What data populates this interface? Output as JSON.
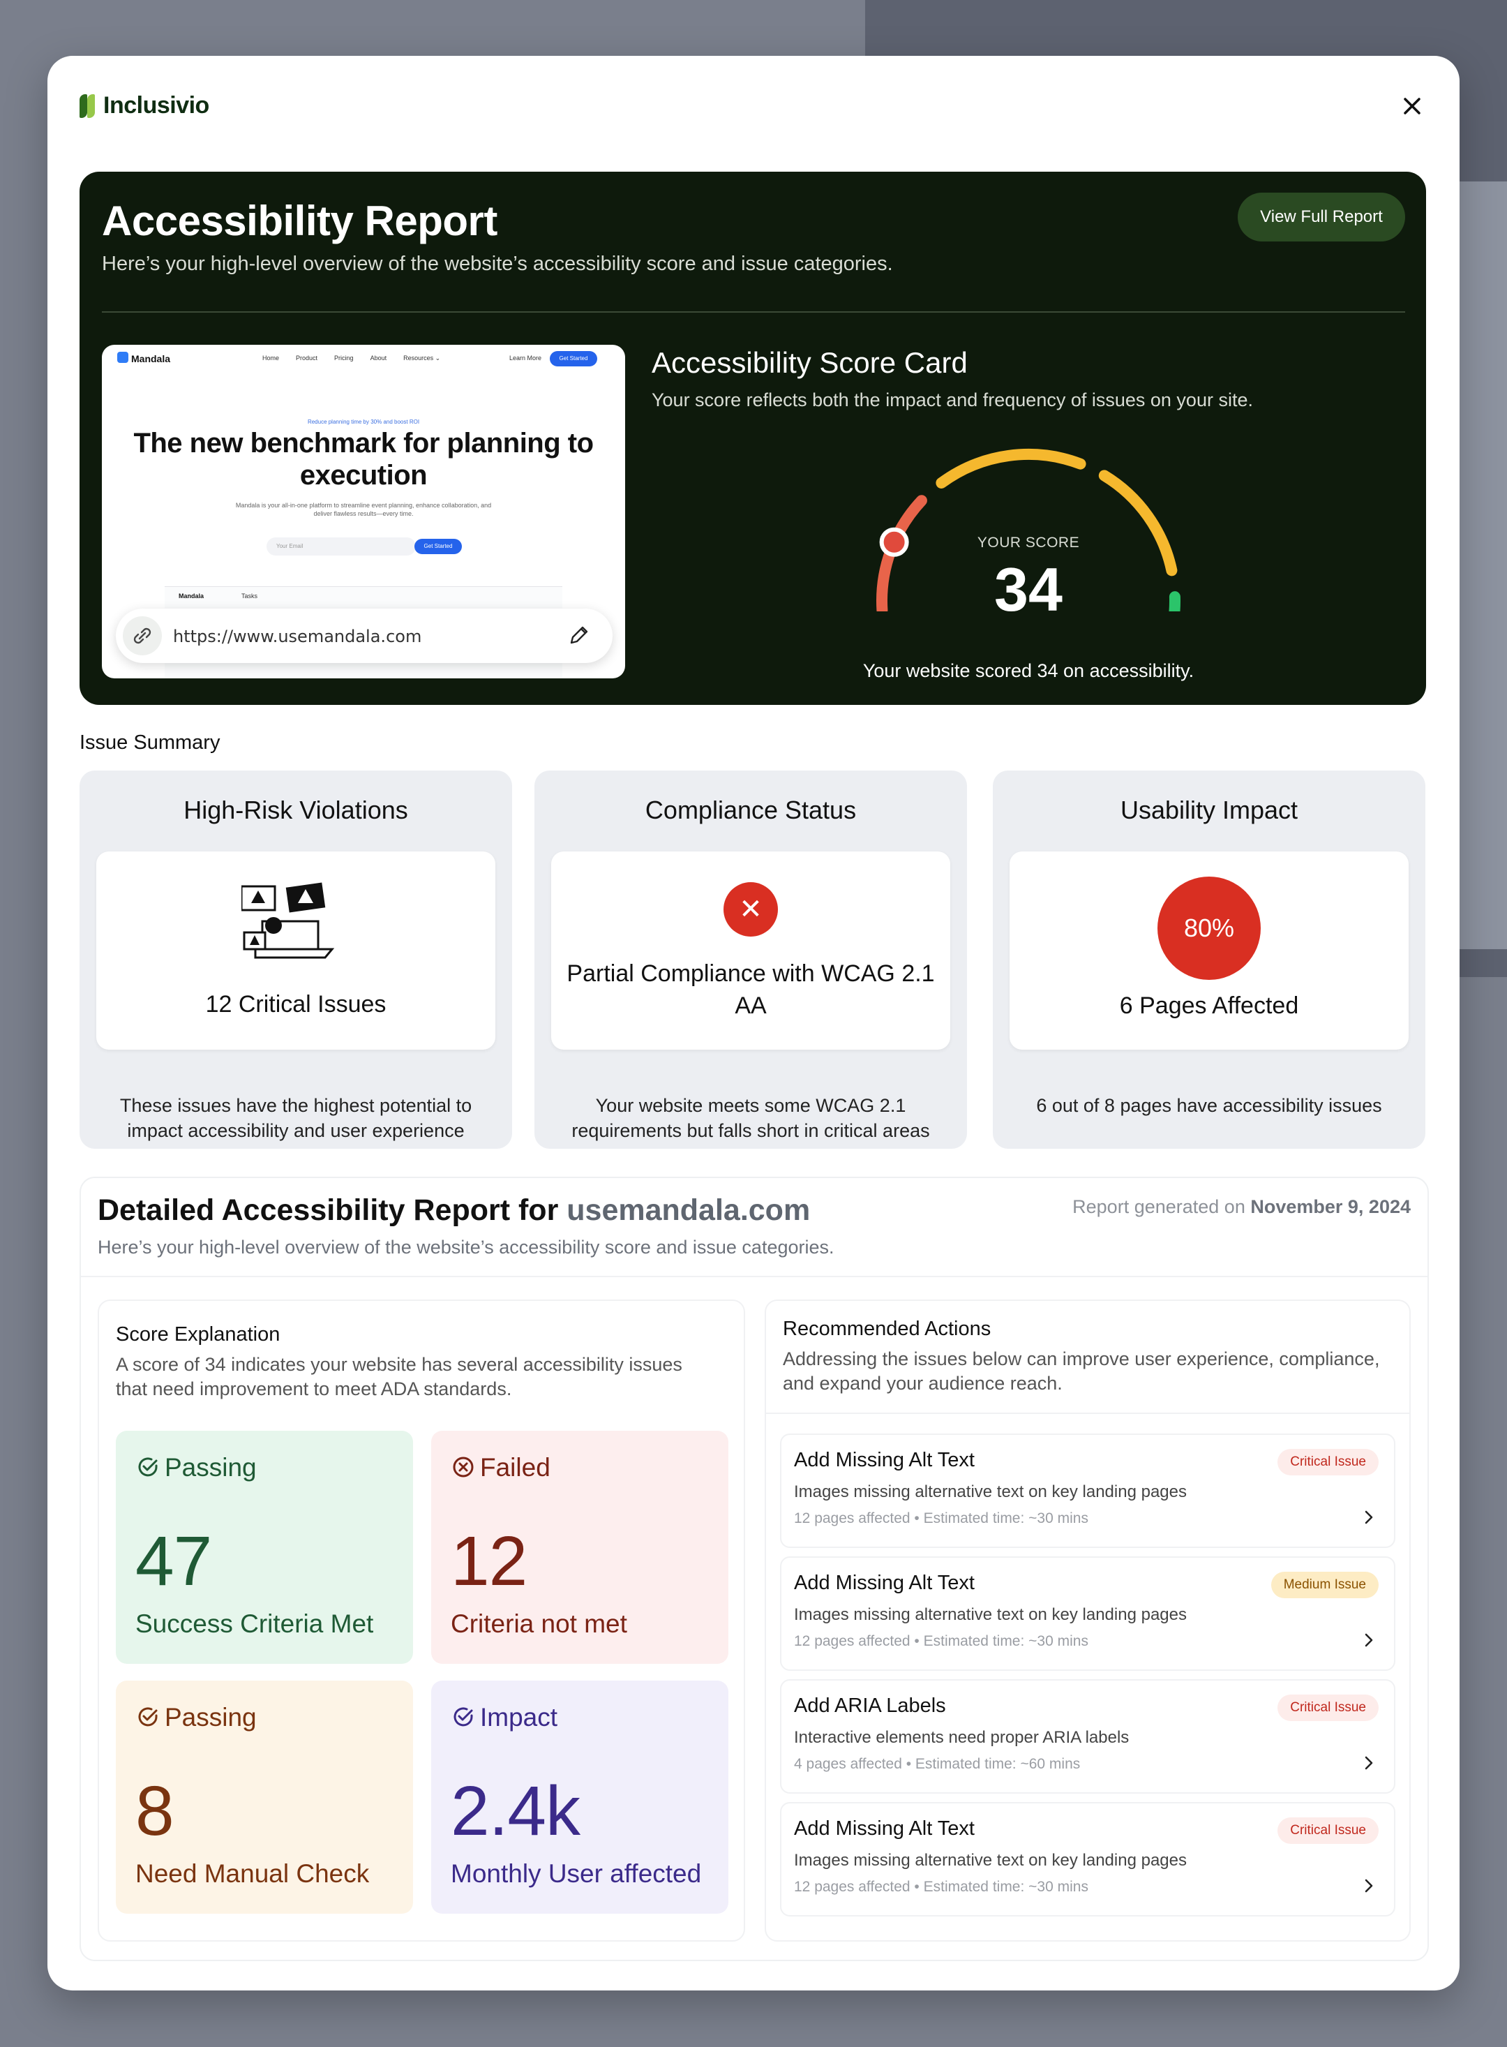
{
  "brand": {
    "name": "Inclusivio"
  },
  "hero": {
    "title": "Accessibility Report",
    "subtitle": "Here’s your high-level overview of the website’s accessibility score and issue categories.",
    "view_full_report": "View Full Report"
  },
  "preview": {
    "brand": "Mandala",
    "nav": [
      "Home",
      "Product",
      "Pricing",
      "About",
      "Resources ⌄"
    ],
    "learn_more": "Learn More",
    "get_started": "Get Started",
    "tagline": "Reduce planning time by 30% and boost ROI",
    "headline": "The new benchmark for planning to execution",
    "body": "Mandala is your all-in-one platform to streamline event planning, enhance collaboration, and deliver flawless results—every time.",
    "email_placeholder": "Your Email",
    "app_brand": "Mandala",
    "app_tab": "Tasks",
    "url": "https://www.usemandala.com"
  },
  "score_card": {
    "title": "Accessibility Score Card",
    "subtitle": "Your score reflects both the impact and frequency of issues on your site.",
    "score_label": "YOUR SCORE",
    "score": "34",
    "score_value": 34,
    "caption": "Your website scored 34 on accessibility.",
    "colors": {
      "low": "#e04a3c",
      "mid": "#f5b82e",
      "high": "#2bc46a"
    }
  },
  "issue_summary": {
    "title": "Issue Summary",
    "cards": [
      {
        "title": "High-Risk Violations",
        "headline": "12 Critical Issues",
        "description": "These issues have the highest potential to impact accessibility and user experience"
      },
      {
        "title": "Compliance Status",
        "headline": "Partial Compliance with WCAG 2.1 AA",
        "description": "Your website meets some WCAG 2.1 requirements but falls short in critical areas"
      },
      {
        "title": "Usability Impact",
        "badge": "80%",
        "headline": "6 Pages Affected",
        "description": "6 out of 8 pages have accessibility issues"
      }
    ]
  },
  "detailed": {
    "title_prefix": "Detailed Accessibility Report for",
    "domain": "usemandala.com",
    "subtitle": "Here’s your high-level overview of the website’s accessibility score and issue categories.",
    "generated_prefix": "Report generated on",
    "generated_date": "November 9, 2024",
    "explanation": {
      "title": "Score Explanation",
      "text": "A score of 34 indicates your website has several accessibility issues that need improvement to meet ADA standards.",
      "tiles": [
        {
          "label": "Passing",
          "value": "47",
          "caption": "Success Criteria Met"
        },
        {
          "label": "Failed",
          "value": "12",
          "caption": "Criteria not met"
        },
        {
          "label": "Passing",
          "value": "8",
          "caption": "Need Manual Check"
        },
        {
          "label": "Impact",
          "value": "2.4k",
          "caption": "Monthly User affected"
        }
      ]
    },
    "actions": {
      "title": "Recommended Actions",
      "text": " Addressing the issues below can improve user experience, compliance, and expand your audience reach.",
      "items": [
        {
          "title": "Add Missing Alt Text",
          "badge": "Critical Issue",
          "desc": "Images missing alternative text on key landing pages",
          "meta": "12 pages affected  • Estimated time: ~30 mins"
        },
        {
          "title": "Add Missing Alt Text",
          "badge": "Medium Issue",
          "desc": "Images missing alternative text on key landing pages",
          "meta": "12 pages affected  • Estimated time: ~30 mins"
        },
        {
          "title": "Add ARIA Labels",
          "badge": "Critical Issue",
          "desc": "Interactive elements need proper ARIA labels",
          "meta": "4 pages affected  • Estimated time: ~60 mins"
        },
        {
          "title": "Add Missing Alt Text",
          "badge": "Critical Issue",
          "desc": "Images missing alternative text on key landing pages",
          "meta": "12 pages affected  • Estimated time: ~30 mins"
        }
      ]
    }
  }
}
